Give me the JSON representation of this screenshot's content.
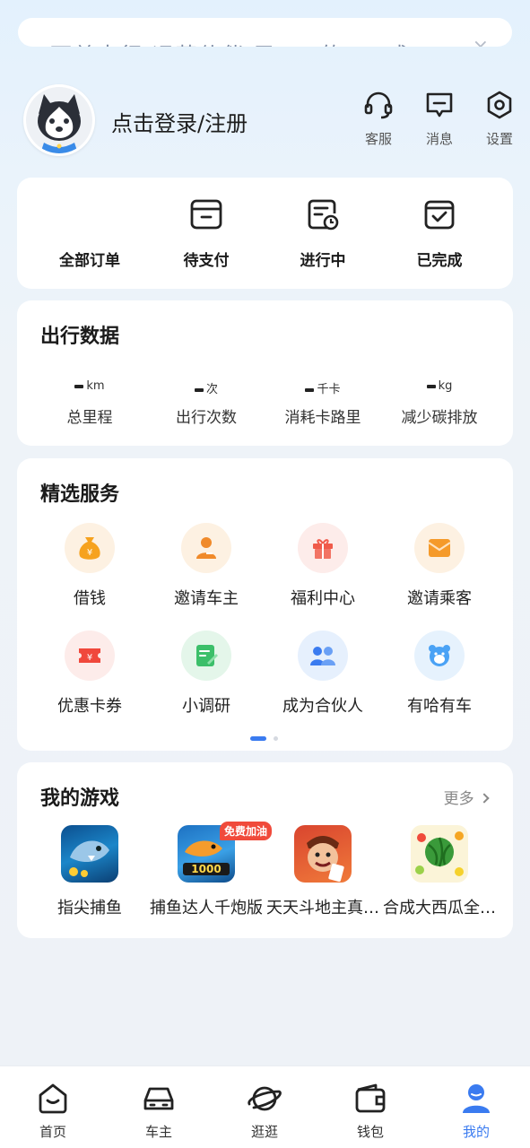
{
  "banner": {
    "text": "下单出行 运营伙伴 已 ... 的 ... 成 ...",
    "close_symbol": "×"
  },
  "profile": {
    "login_text": "点击登录/注册"
  },
  "top_actions": [
    {
      "label": "客服",
      "icon": "headset-icon"
    },
    {
      "label": "消息",
      "icon": "message-icon"
    },
    {
      "label": "设置",
      "icon": "settings-icon"
    }
  ],
  "orders": [
    {
      "label": "全部订单"
    },
    {
      "label": "待支付",
      "icon": "wallet-card-icon"
    },
    {
      "label": "进行中",
      "icon": "in-progress-icon"
    },
    {
      "label": "已完成",
      "icon": "completed-icon"
    }
  ],
  "travel": {
    "title": "出行数据",
    "stats": [
      {
        "unit": "km",
        "label": "总里程"
      },
      {
        "unit": "次",
        "label": "出行次数"
      },
      {
        "unit": "千卡",
        "label": "消耗卡路里"
      },
      {
        "unit": "kg",
        "label": "减少碳排放"
      }
    ]
  },
  "services": {
    "title": "精选服务",
    "items": [
      {
        "label": "借钱",
        "icon": "money-bag-icon",
        "color": "#f6a21e"
      },
      {
        "label": "邀请车主",
        "icon": "invite-driver-icon",
        "color": "#f08a2a"
      },
      {
        "label": "福利中心",
        "icon": "gift-icon",
        "color": "#f05a4a"
      },
      {
        "label": "邀请乘客",
        "icon": "envelope-icon",
        "color": "#f59a2a"
      },
      {
        "label": "优惠卡券",
        "icon": "coupon-icon",
        "color": "#f0483c"
      },
      {
        "label": "小调研",
        "icon": "survey-icon",
        "color": "#3cbf6a"
      },
      {
        "label": "成为合伙人",
        "icon": "partners-icon",
        "color": "#3a7bf0"
      },
      {
        "label": "有哈有车",
        "icon": "bear-icon",
        "color": "#4aa2f5"
      }
    ]
  },
  "games": {
    "title": "我的游戏",
    "more_label": "更多",
    "badge": "免费加油",
    "items": [
      {
        "label": "指尖捕鱼"
      },
      {
        "label": "捕鱼达人千炮版"
      },
      {
        "label": "天天斗地主真人版"
      },
      {
        "label": "合成大西瓜全民版"
      }
    ]
  },
  "nav": [
    {
      "label": "首页",
      "icon": "home-icon"
    },
    {
      "label": "车主",
      "icon": "car-icon"
    },
    {
      "label": "逛逛",
      "icon": "planet-icon"
    },
    {
      "label": "钱包",
      "icon": "wallet-icon"
    },
    {
      "label": "我的",
      "icon": "profile-icon",
      "active": true
    }
  ],
  "colors": {
    "accent": "#3a7bf0",
    "background": "#eef2f7"
  }
}
